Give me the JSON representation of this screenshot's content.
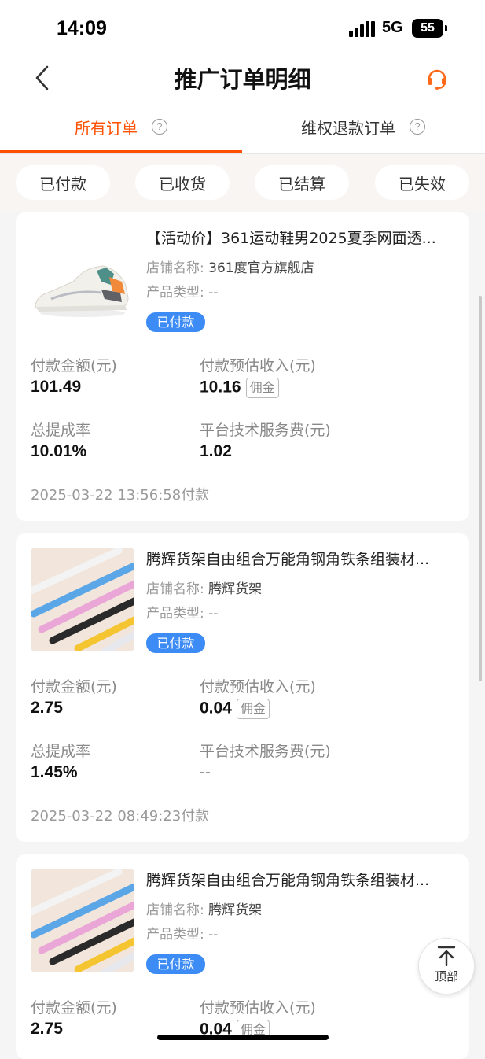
{
  "status_bar": {
    "time": "14:09",
    "network": "5G",
    "battery": "55"
  },
  "nav": {
    "title": "推广订单明细"
  },
  "tabs": [
    {
      "label": "所有订单",
      "active": true
    },
    {
      "label": "维权退款订单",
      "active": false
    }
  ],
  "filters": [
    "已付款",
    "已收货",
    "已结算",
    "已失效"
  ],
  "orders": [
    {
      "title": "【活动价】361运动鞋男2025夏季网面透...",
      "shop_label": "店铺名称:",
      "shop": "361度官方旗舰店",
      "type_label": "产品类型:",
      "type": "--",
      "status": "已付款",
      "pay_amount_label": "付款金额(元)",
      "pay_amount": "101.49",
      "est_income_label": "付款预估收入(元)",
      "est_income": "10.16",
      "tag": "佣金",
      "rate_label": "总提成率",
      "rate": "10.01%",
      "fee_label": "平台技术服务费(元)",
      "fee": "1.02",
      "time": "2025-03-22 13:56:58付款"
    },
    {
      "title": "腾辉货架自由组合万能角钢角铁条组装材...",
      "shop_label": "店铺名称:",
      "shop": "腾辉货架",
      "type_label": "产品类型:",
      "type": "--",
      "status": "已付款",
      "pay_amount_label": "付款金额(元)",
      "pay_amount": "2.75",
      "est_income_label": "付款预估收入(元)",
      "est_income": "0.04",
      "tag": "佣金",
      "rate_label": "总提成率",
      "rate": "1.45%",
      "fee_label": "平台技术服务费(元)",
      "fee": "--",
      "time": "2025-03-22 08:49:23付款"
    },
    {
      "title": "腾辉货架自由组合万能角钢角铁条组装材...",
      "shop_label": "店铺名称:",
      "shop": "腾辉货架",
      "type_label": "产品类型:",
      "type": "--",
      "status": "已付款",
      "pay_amount_label": "付款金额(元)",
      "pay_amount": "2.75",
      "est_income_label": "付款预估收入(元)",
      "est_income": "0.04",
      "tag": "佣金"
    }
  ],
  "back_to_top": "顶部",
  "colors": {
    "accent": "#ff5000",
    "badge": "#3d8cf5",
    "support_icon": "#ff6a1a"
  }
}
